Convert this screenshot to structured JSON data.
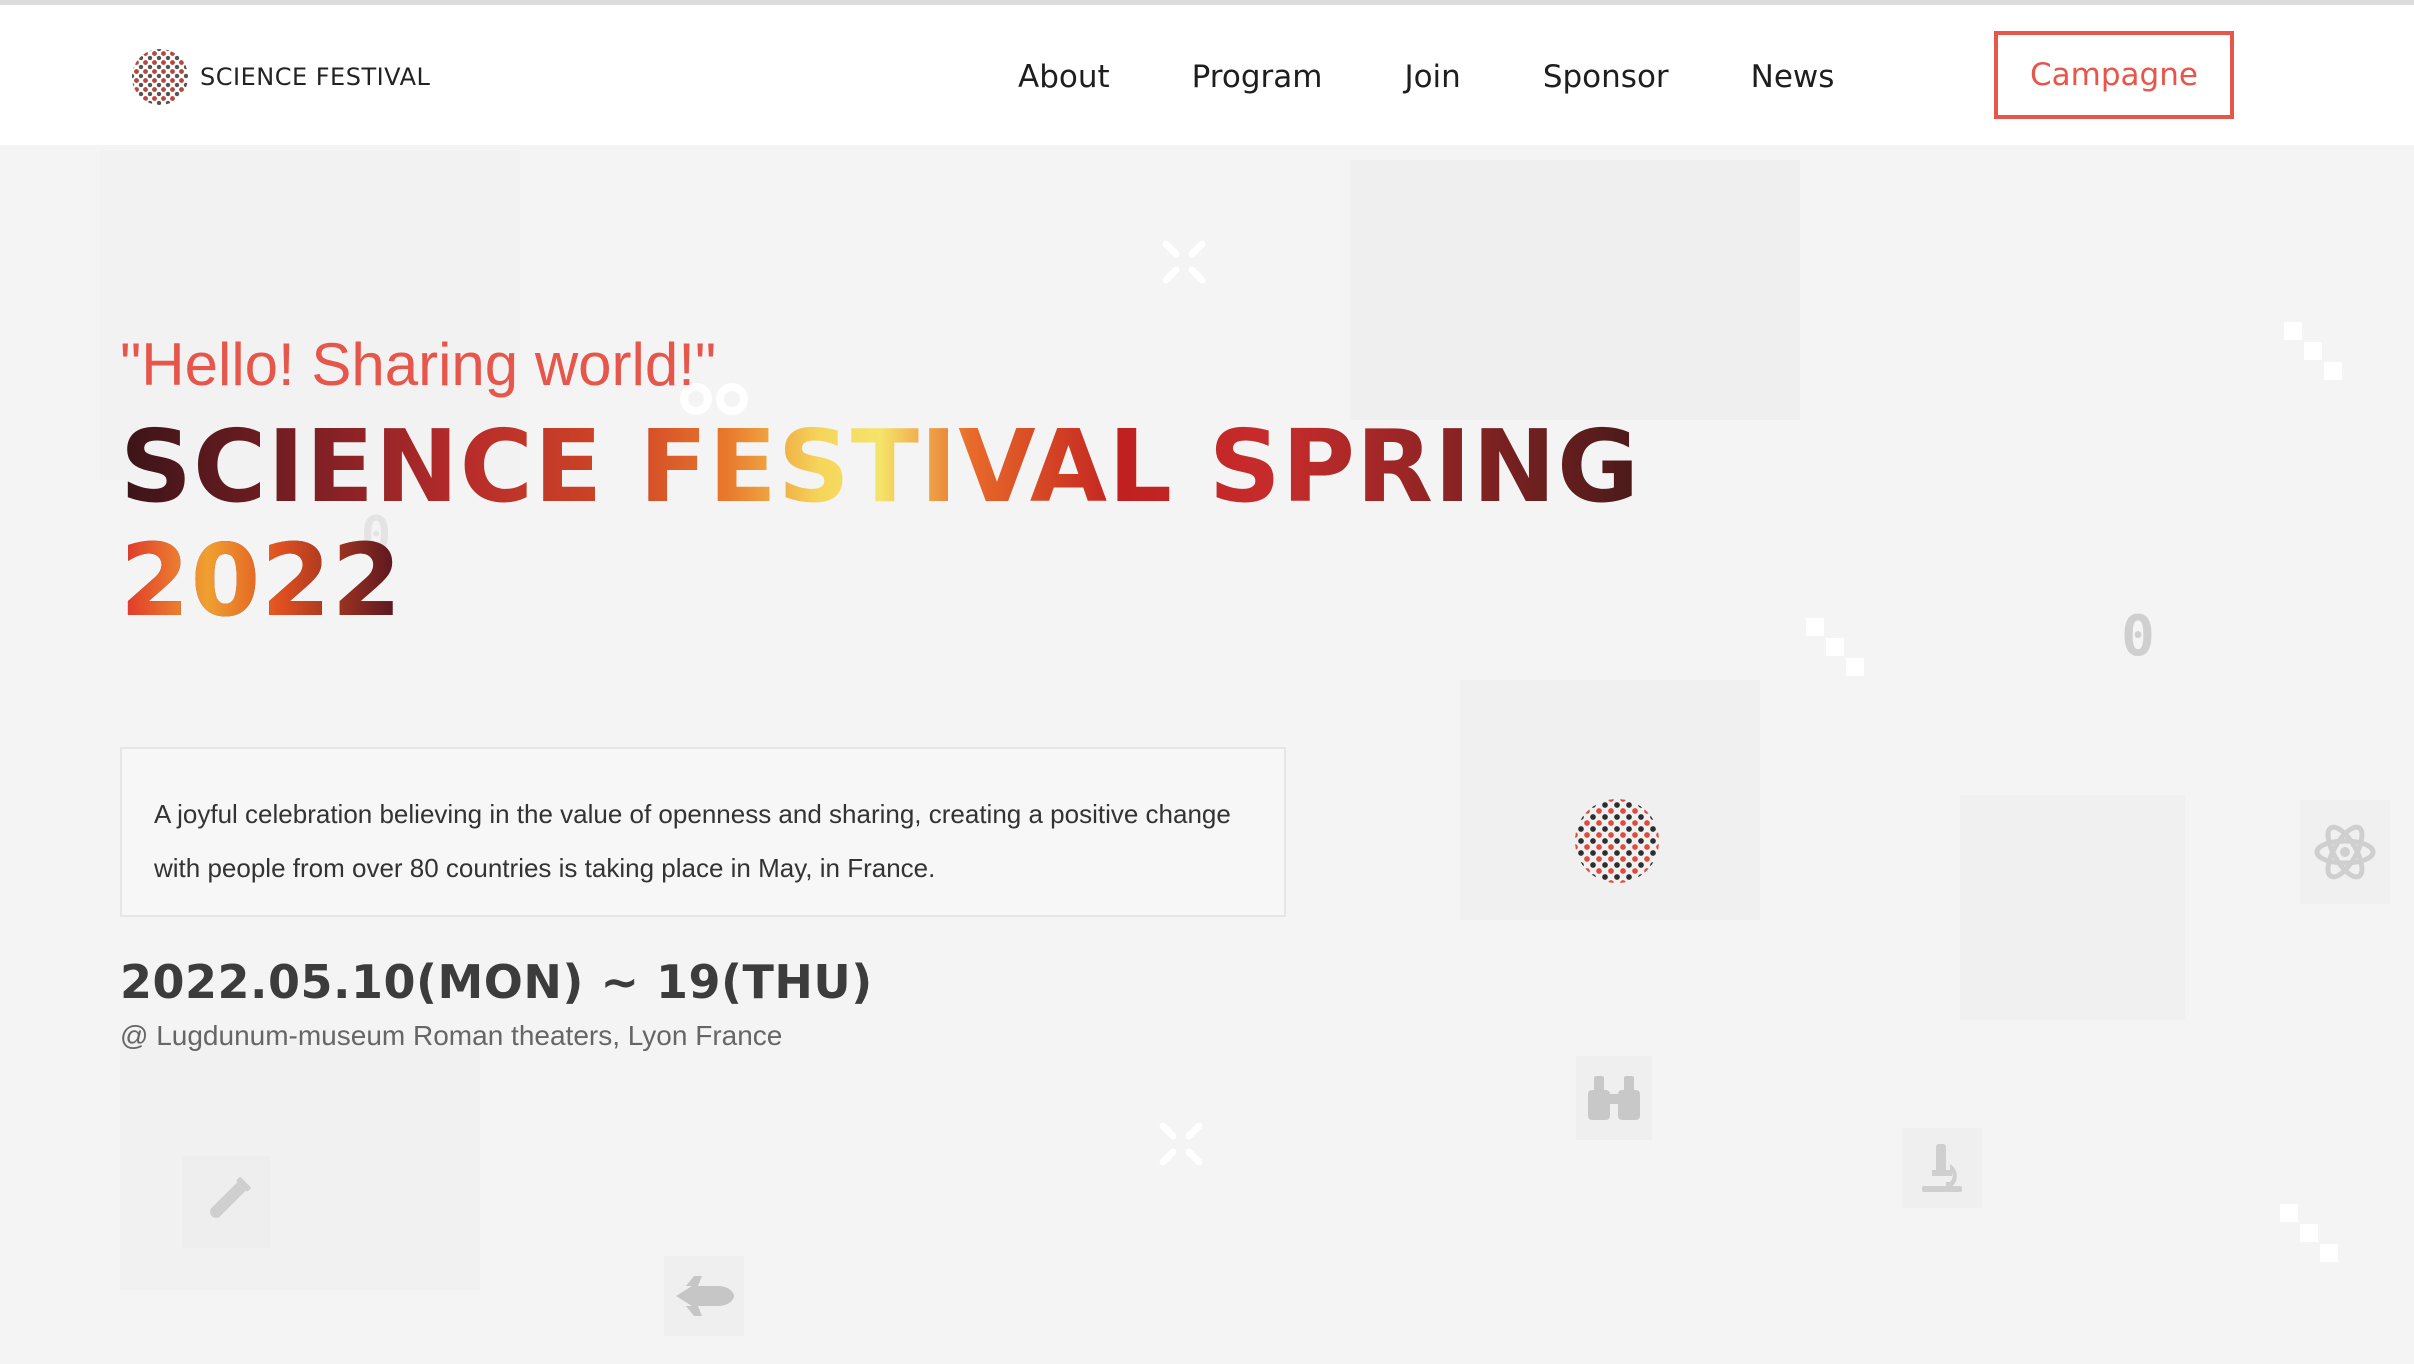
{
  "header": {
    "logo_text": "SCIENCE FESTIVAL",
    "nav": [
      "About",
      "Program",
      "Join",
      "Sponsor",
      "News"
    ],
    "cta_label": "Campagne"
  },
  "hero": {
    "tagline": "\"Hello! Sharing world!\"",
    "title_line1": "SCIENCE FESTIVAL SPRING",
    "title_line2": "2022",
    "description": "A joyful celebration believing in the value of openness and sharing, creating a positive change with people from over 80 countries is taking place in May, in France.",
    "date": "2022.05.10(MON) ~ 19(THU)",
    "location": "@ Lugdunum-museum Roman theaters, Lyon France"
  },
  "decor_glyphs": {
    "zero": "0"
  },
  "colors": {
    "accent": "#e6564a",
    "title_dark": "#3a1418",
    "title_yellow": "#f5e46a"
  },
  "icons": [
    "close-x-icon",
    "pixel-steps-icon",
    "zero-icon",
    "dotted-globe-icon",
    "atom-icon",
    "binoculars-icon",
    "microscope-icon",
    "test-tube-icon",
    "space-shuttle-icon",
    "loop-icon"
  ]
}
